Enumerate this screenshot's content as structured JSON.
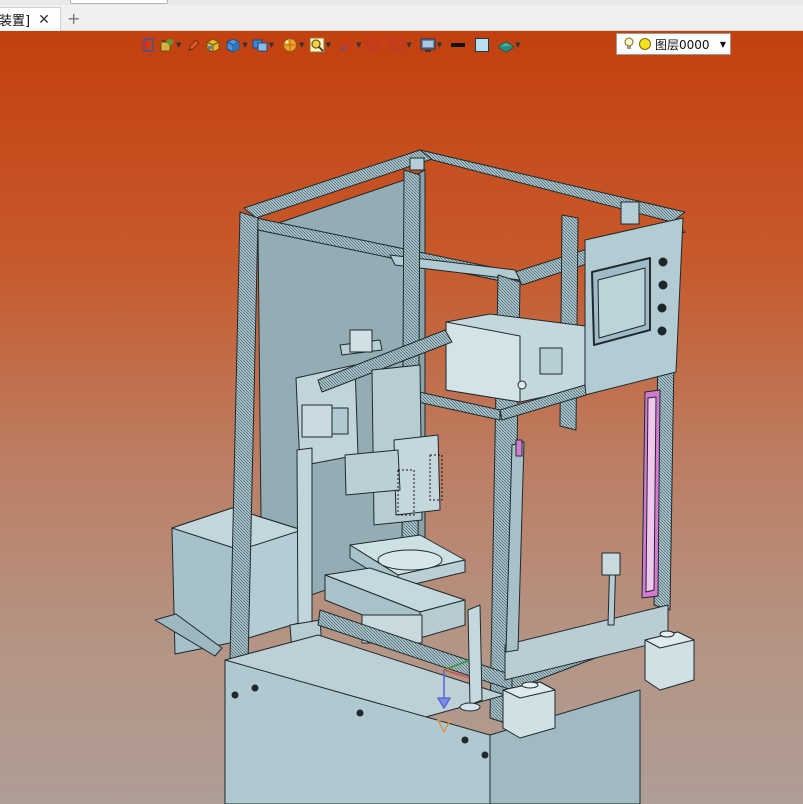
{
  "tab": {
    "label": "装置]",
    "close_glyph": "✕",
    "new_glyph": "+"
  },
  "toolbar": {
    "items": [
      {
        "name": "exit-sketch-icon",
        "dropdown": false
      },
      {
        "name": "view-orient-icon",
        "dropdown": true
      },
      {
        "name": "sketch-pen-icon",
        "dropdown": false
      },
      {
        "name": "solid-box-icon",
        "dropdown": false
      },
      {
        "name": "cube-display-icon",
        "dropdown": true
      },
      {
        "name": "section-view-icon",
        "dropdown": true
      },
      {
        "name": "appearance-ball-icon",
        "dropdown": true
      },
      {
        "name": "zoom-area-icon",
        "dropdown": true
      },
      {
        "name": "cross-axis-icon",
        "dropdown": true
      },
      {
        "name": "rotate-view-icon",
        "dropdown": false
      },
      {
        "name": "section-plane-icon",
        "dropdown": true
      },
      {
        "name": "display-monitor-icon",
        "dropdown": true
      },
      {
        "name": "line-color-icon",
        "dropdown": false
      },
      {
        "name": "face-color-icon",
        "dropdown": false
      },
      {
        "name": "plane-layer-icon",
        "dropdown": true
      }
    ],
    "layer_label": "图层0000",
    "layer_icons": [
      "bulb-icon",
      "sun-icon"
    ]
  },
  "colors": {
    "bg_top": "#c3400f",
    "bg_bottom": "#ae9d96",
    "model_face": "#a6c2cb",
    "model_edge": "#1e2a2e",
    "frame": "#8fb1bb",
    "accent_pink": "#d47ad0"
  }
}
